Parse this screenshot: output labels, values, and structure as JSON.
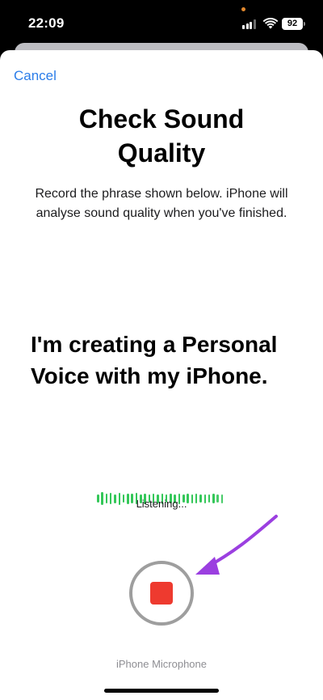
{
  "status_bar": {
    "time": "22:09",
    "battery": "92",
    "icons": [
      "signal-icon",
      "wifi-icon",
      "battery-icon"
    ]
  },
  "sheet": {
    "cancel_label": "Cancel",
    "title": "Check Sound Quality",
    "subtitle": "Record the phrase shown below. iPhone will analyse sound quality when you've finished.",
    "phrase": "I'm creating a Personal Voice with my iPhone.",
    "status": "Listening...",
    "mic_label": "iPhone Microphone"
  },
  "colors": {
    "accent": "#2b7de9",
    "record": "#ee3a2f",
    "waveform": "#34c759",
    "annotation_arrow": "#9b3fe0"
  }
}
